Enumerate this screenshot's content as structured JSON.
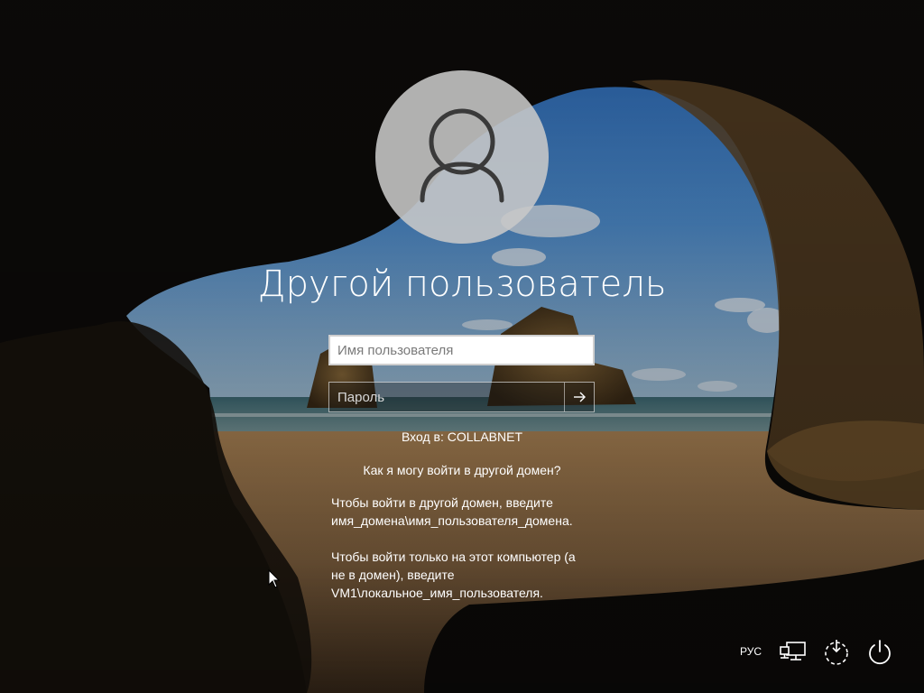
{
  "login": {
    "title": "Другой пользователь",
    "username_placeholder": "Имя пользователя",
    "password_placeholder": "Пароль",
    "signin_to": "Вход в: COLLABNET",
    "domain_help_link": "Как я могу войти в другой домен?",
    "help_para_1": [
      "Чтобы войти в другой домен, введите",
      "имя_домена\\имя_пользователя_домена."
    ],
    "help_para_2": [
      "Чтобы войти только на этот компьютер (а",
      "не в домен), введите",
      "VM1\\локальное_имя_пользователя."
    ]
  },
  "tray": {
    "language": "РУС",
    "icons": [
      "network-icon",
      "ease-of-access-icon",
      "power-icon"
    ]
  },
  "colors": {
    "text": "#ffffff",
    "avatar_bg": "#c8c8c8",
    "avatar_glyph": "#3a3a3a",
    "sky": "#2f6fb8",
    "sea": "#5c8f9d",
    "sand": "#c9a068",
    "cave": "#0d0b09"
  }
}
